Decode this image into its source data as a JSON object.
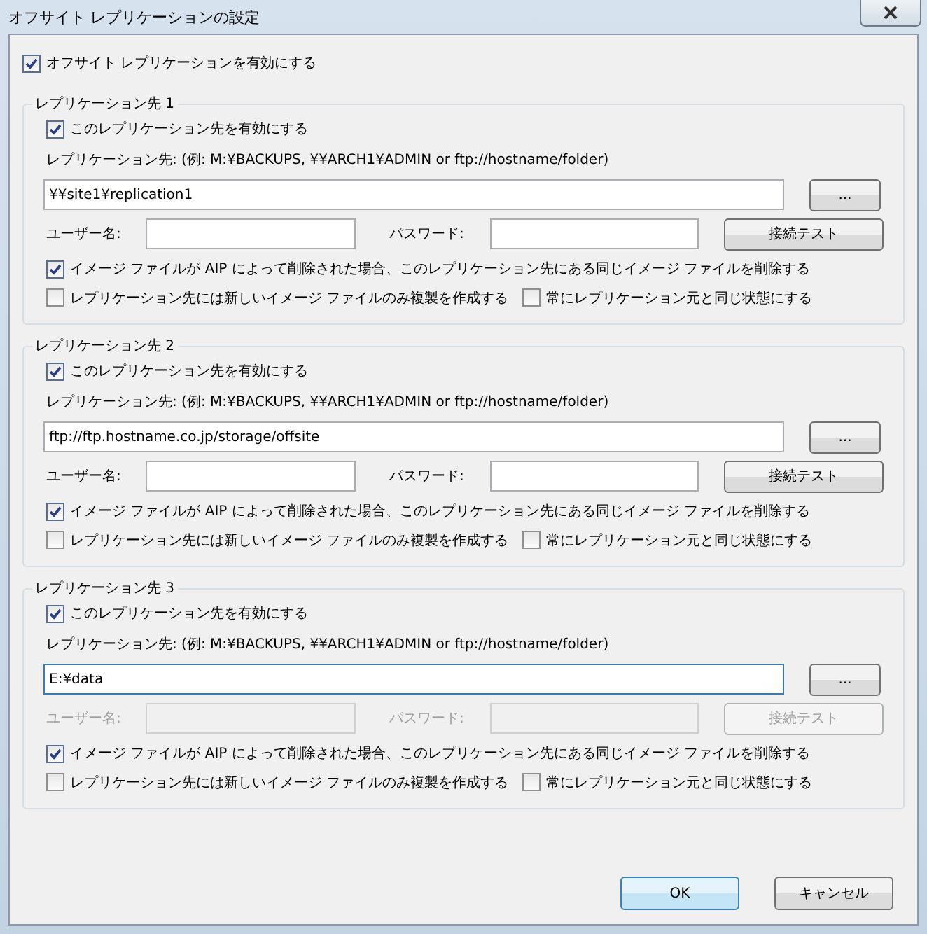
{
  "window": {
    "title": "オフサイト レプリケーションの設定"
  },
  "enable_offsite": {
    "label": "オフサイト レプリケーションを有効にする",
    "checked": true
  },
  "destinations": [
    {
      "title": "レプリケーション先 1",
      "enable": {
        "label": "このレプリケーション先を有効にする",
        "checked": true
      },
      "path_label": "レプリケーション先: (例:  M:¥BACKUPS,  ¥¥ARCH1¥ADMIN or ftp://hostname/folder)",
      "path": {
        "value": "¥¥site1¥replication1",
        "focused": false
      },
      "browse_button": "...",
      "username_label": "ユーザー名:",
      "password_label": "パスワード:",
      "test_button": "接続テスト",
      "credentials_disabled": false,
      "options": [
        {
          "label": "イメージ ファイルが AIP によって削除された場合、このレプリケーション先にある同じイメージ ファイルを削除する",
          "checked": true
        },
        {
          "label": "レプリケーション先には新しいイメージ ファイルのみ複製を作成する",
          "checked": false
        },
        {
          "label": "常にレプリケーション元と同じ状態にする",
          "checked": false
        }
      ]
    },
    {
      "title": "レプリケーション先 2",
      "enable": {
        "label": "このレプリケーション先を有効にする",
        "checked": true
      },
      "path_label": "レプリケーション先: (例:  M:¥BACKUPS,  ¥¥ARCH1¥ADMIN or ftp://hostname/folder)",
      "path": {
        "value": "ftp://ftp.hostname.co.jp/storage/offsite",
        "focused": false
      },
      "browse_button": "...",
      "username_label": "ユーザー名:",
      "password_label": "パスワード:",
      "test_button": "接続テスト",
      "credentials_disabled": false,
      "options": [
        {
          "label": "イメージ ファイルが AIP によって削除された場合、このレプリケーション先にある同じイメージ ファイルを削除する",
          "checked": true
        },
        {
          "label": "レプリケーション先には新しいイメージ ファイルのみ複製を作成する",
          "checked": false
        },
        {
          "label": "常にレプリケーション元と同じ状態にする",
          "checked": false
        }
      ]
    },
    {
      "title": "レプリケーション先 3",
      "enable": {
        "label": "このレプリケーション先を有効にする",
        "checked": true
      },
      "path_label": "レプリケーション先: (例:  M:¥BACKUPS,  ¥¥ARCH1¥ADMIN or ftp://hostname/folder)",
      "path": {
        "value": "E:¥data",
        "focused": true
      },
      "browse_button": "...",
      "username_label": "ユーザー名:",
      "password_label": "パスワード:",
      "test_button": "接続テスト",
      "credentials_disabled": true,
      "options": [
        {
          "label": "イメージ ファイルが AIP によって削除された場合、このレプリケーション先にある同じイメージ ファイルを削除する",
          "checked": true
        },
        {
          "label": "レプリケーション先には新しいイメージ ファイルのみ複製を作成する",
          "checked": false
        },
        {
          "label": "常にレプリケーション元と同じ状態にする",
          "checked": false
        }
      ]
    }
  ],
  "buttons": [
    {
      "label": "OK",
      "default": true
    },
    {
      "label": "キャンセル",
      "default": false
    }
  ]
}
